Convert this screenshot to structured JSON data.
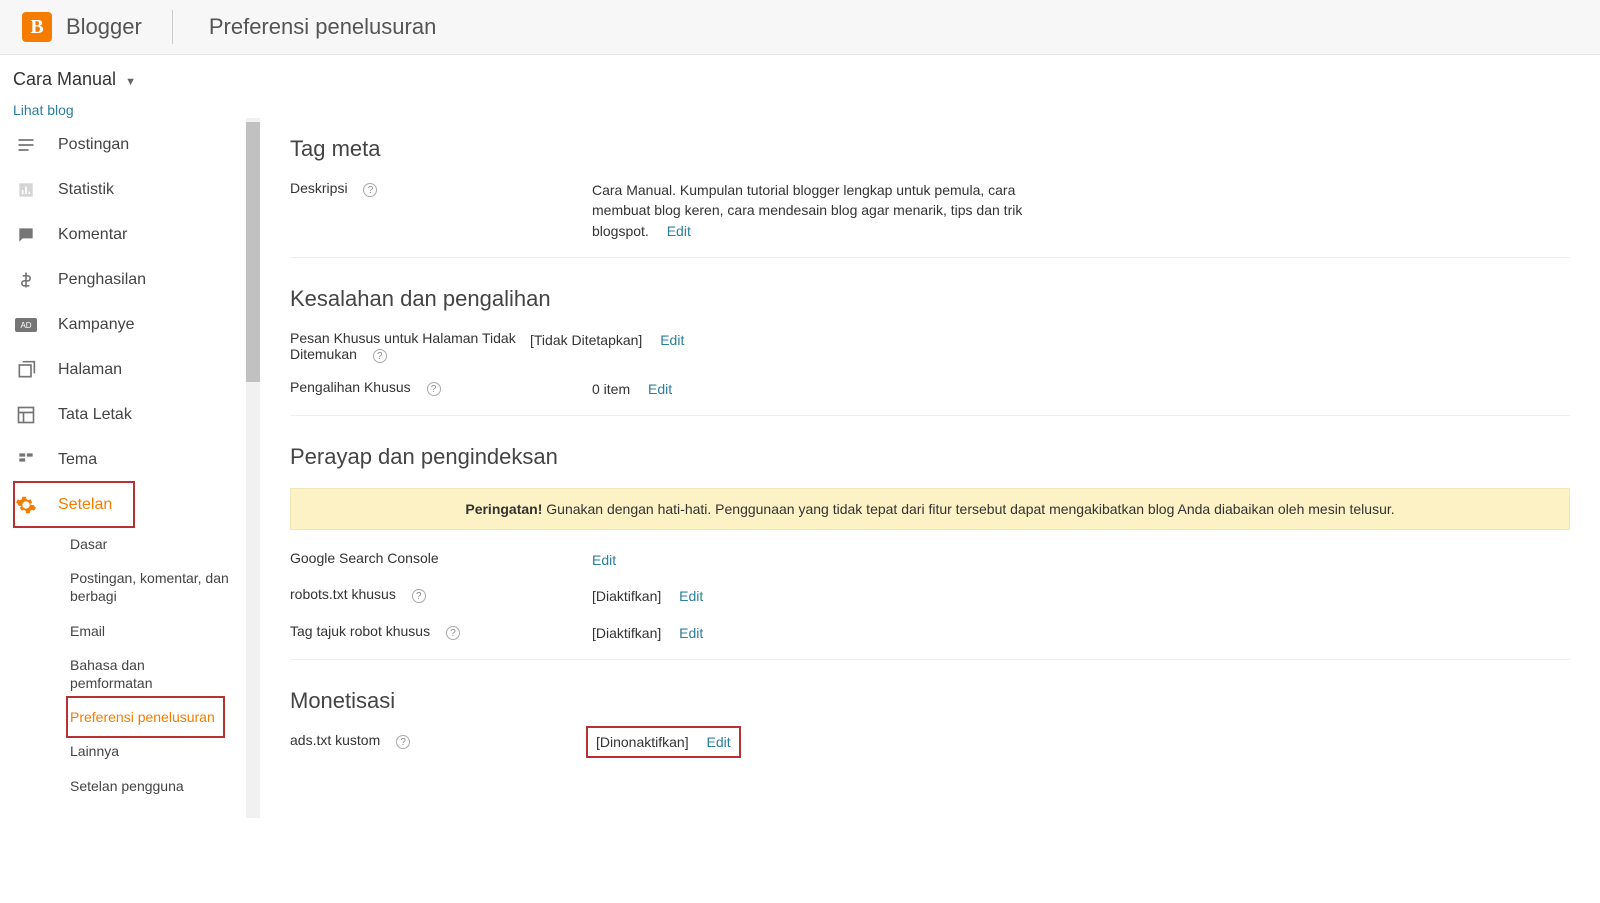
{
  "header": {
    "brand": "Blogger",
    "page_title": "Preferensi penelusuran"
  },
  "blog_switcher": {
    "name": "Cara Manual"
  },
  "view_blog_label": "Lihat blog",
  "sidebar": {
    "items": [
      {
        "label": "Postingan"
      },
      {
        "label": "Statistik"
      },
      {
        "label": "Komentar"
      },
      {
        "label": "Penghasilan"
      },
      {
        "label": "Kampanye"
      },
      {
        "label": "Halaman"
      },
      {
        "label": "Tata Letak"
      },
      {
        "label": "Tema"
      },
      {
        "label": "Setelan"
      }
    ],
    "sub_items": [
      {
        "label": "Dasar"
      },
      {
        "label": "Postingan, komentar, dan berbagi"
      },
      {
        "label": "Email"
      },
      {
        "label": "Bahasa dan pemformatan"
      },
      {
        "label": "Preferensi penelusuran"
      },
      {
        "label": "Lainnya"
      },
      {
        "label": "Setelan pengguna"
      }
    ]
  },
  "sections": {
    "meta": {
      "title": "Tag meta",
      "desc_label": "Deskripsi",
      "desc_value": "Cara Manual. Kumpulan tutorial blogger lengkap untuk pemula, cara membuat blog keren, cara mendesain blog agar menarik, tips dan trik blogspot.",
      "edit": "Edit"
    },
    "errors": {
      "title": "Kesalahan dan pengalihan",
      "notfound_label": "Pesan Khusus untuk Halaman Tidak Ditemukan",
      "notfound_value": "[Tidak Ditetapkan]",
      "redirect_label": "Pengalihan Khusus",
      "redirect_value": "0 item",
      "edit": "Edit"
    },
    "crawl": {
      "title": "Perayap dan pengindeksan",
      "warning_bold": "Peringatan!",
      "warning": "Gunakan dengan hati-hati. Penggunaan yang tidak tepat dari fitur tersebut dapat mengakibatkan blog Anda diabaikan oleh mesin telusur.",
      "gsc_label": "Google Search Console",
      "robots_label": "robots.txt khusus",
      "robots_value": "[Diaktifkan]",
      "header_label": "Tag tajuk robot khusus",
      "header_value": "[Diaktifkan]",
      "edit": "Edit"
    },
    "monet": {
      "title": "Monetisasi",
      "ads_label": "ads.txt kustom",
      "ads_value": "[Dinonaktifkan]",
      "edit": "Edit"
    }
  }
}
